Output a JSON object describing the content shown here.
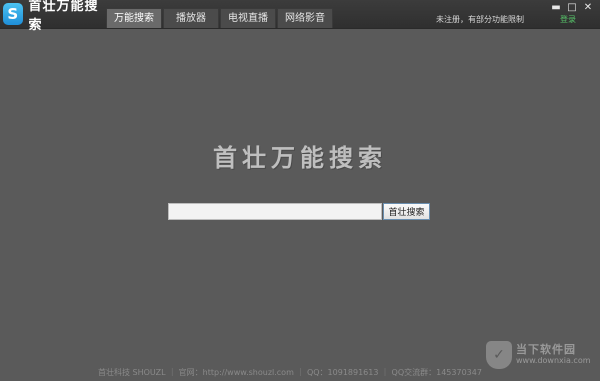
{
  "app": {
    "logo_glyph": "S",
    "name": "首壮万能搜索"
  },
  "tabs": [
    {
      "label": "万能搜索",
      "active": true
    },
    {
      "label": "播放器",
      "active": false
    },
    {
      "label": "电视直播",
      "active": false
    },
    {
      "label": "网络影音",
      "active": false
    }
  ],
  "header": {
    "notice": "未注册，有部分功能限制",
    "login_label": "登录",
    "login_color": "#57c66a"
  },
  "window_controls": {
    "minimize": "▬",
    "maximize": "□",
    "close": "✕"
  },
  "main": {
    "title": "首壮万能搜索",
    "search": {
      "value": "",
      "placeholder": "",
      "button_label": "首壮搜索"
    }
  },
  "footer": {
    "text": "首壮科技 SHOUZL ｜ 官网：http://www.shouzl.com ｜ QQ：1091891613 ｜ QQ交流群：145370347"
  },
  "watermark": {
    "name": "当下软件园",
    "url": "www.downxia.com"
  }
}
